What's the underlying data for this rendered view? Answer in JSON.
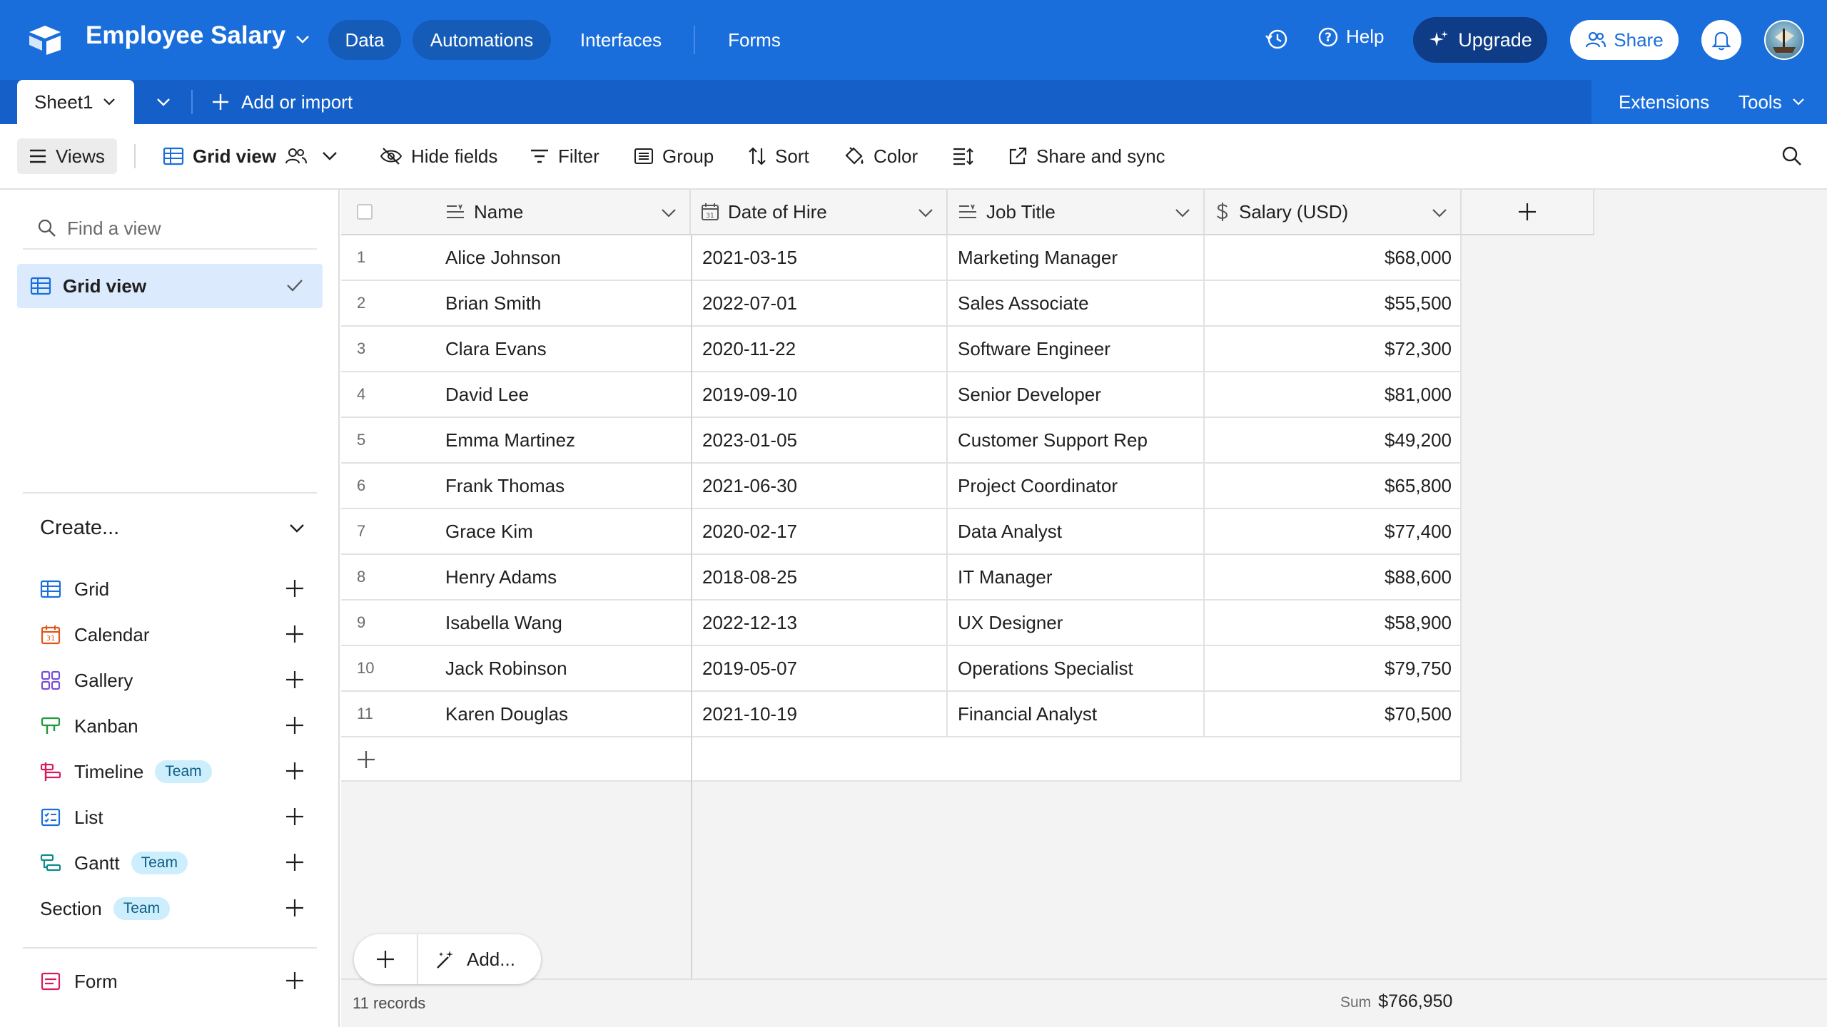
{
  "app": {
    "base_name": "Employee Salary",
    "nav": [
      "Data",
      "Automations",
      "Interfaces",
      "Forms"
    ],
    "help": "Help",
    "upgrade": "Upgrade",
    "share": "Share"
  },
  "tabs": {
    "sheet": "Sheet1",
    "add_import": "Add or import",
    "extensions": "Extensions",
    "tools": "Tools"
  },
  "toolbar": {
    "views": "Views",
    "grid_view": "Grid view",
    "hide_fields": "Hide fields",
    "filter": "Filter",
    "group": "Group",
    "sort": "Sort",
    "color": "Color",
    "share_sync": "Share and sync"
  },
  "sidebar": {
    "find_placeholder": "Find a view",
    "active_view": "Grid view",
    "create_label": "Create...",
    "create_items": [
      {
        "label": "Grid",
        "icon": "grid-icon",
        "badge": ""
      },
      {
        "label": "Calendar",
        "icon": "calendar-icon",
        "badge": ""
      },
      {
        "label": "Gallery",
        "icon": "gallery-icon",
        "badge": ""
      },
      {
        "label": "Kanban",
        "icon": "kanban-icon",
        "badge": ""
      },
      {
        "label": "Timeline",
        "icon": "timeline-icon",
        "badge": "Team"
      },
      {
        "label": "List",
        "icon": "list-icon",
        "badge": ""
      },
      {
        "label": "Gantt",
        "icon": "gantt-icon",
        "badge": "Team"
      },
      {
        "label": "Section",
        "icon": "",
        "badge": "Team"
      },
      {
        "label": "Form",
        "icon": "form-icon",
        "badge": ""
      }
    ]
  },
  "grid": {
    "columns": [
      "Name",
      "Date of Hire",
      "Job Title",
      "Salary (USD)"
    ],
    "rows": [
      {
        "n": "1",
        "name": "Alice Johnson",
        "date": "2021-03-15",
        "title": "Marketing Manager",
        "salary": "$68,000"
      },
      {
        "n": "2",
        "name": "Brian Smith",
        "date": "2022-07-01",
        "title": "Sales Associate",
        "salary": "$55,500"
      },
      {
        "n": "3",
        "name": "Clara Evans",
        "date": "2020-11-22",
        "title": "Software Engineer",
        "salary": "$72,300"
      },
      {
        "n": "4",
        "name": "David Lee",
        "date": "2019-09-10",
        "title": "Senior Developer",
        "salary": "$81,000"
      },
      {
        "n": "5",
        "name": "Emma Martinez",
        "date": "2023-01-05",
        "title": "Customer Support Rep",
        "salary": "$49,200"
      },
      {
        "n": "6",
        "name": "Frank Thomas",
        "date": "2021-06-30",
        "title": "Project Coordinator",
        "salary": "$65,800"
      },
      {
        "n": "7",
        "name": "Grace Kim",
        "date": "2020-02-17",
        "title": "Data Analyst",
        "salary": "$77,400"
      },
      {
        "n": "8",
        "name": "Henry Adams",
        "date": "2018-08-25",
        "title": "IT Manager",
        "salary": "$88,600"
      },
      {
        "n": "9",
        "name": "Isabella Wang",
        "date": "2022-12-13",
        "title": "UX Designer",
        "salary": "$58,900"
      },
      {
        "n": "10",
        "name": "Jack Robinson",
        "date": "2019-05-07",
        "title": "Operations Specialist",
        "salary": "$79,750"
      },
      {
        "n": "11",
        "name": "Karen Douglas",
        "date": "2021-10-19",
        "title": "Financial Analyst",
        "salary": "$70,500"
      }
    ],
    "add_label": "Add...",
    "records": "11 records",
    "sum_label": "Sum",
    "sum_value": "$766,950"
  },
  "colors": {
    "brand": "#1a6edc",
    "upgrade": "#0f3c86",
    "selected_view": "#dbeafd",
    "badge": "#cdeefc"
  }
}
